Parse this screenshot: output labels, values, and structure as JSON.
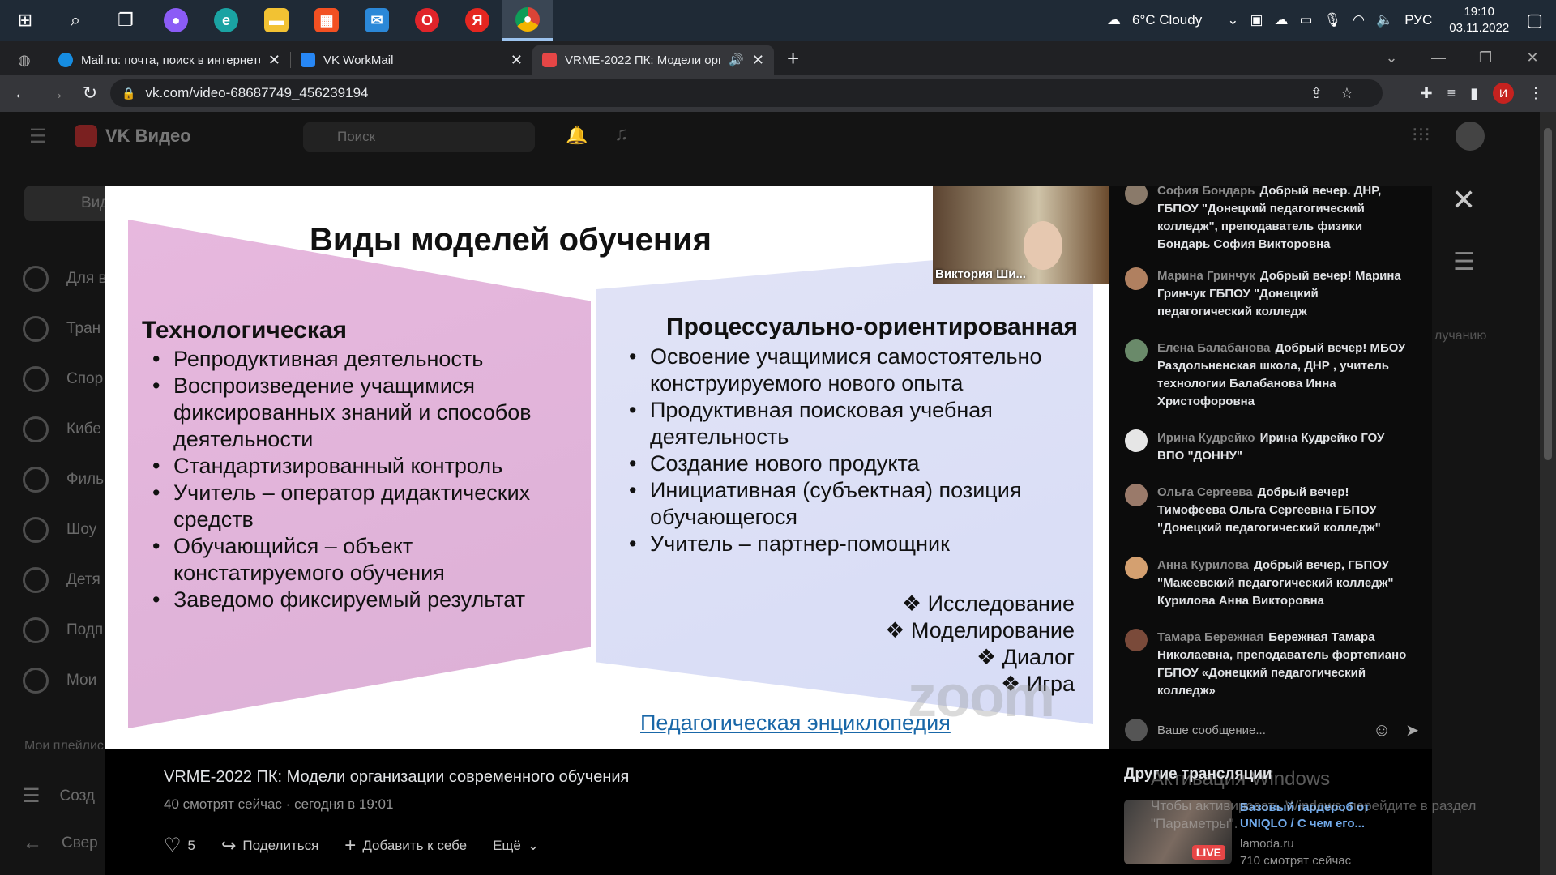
{
  "taskbar": {
    "weather": "6°C  Cloudy",
    "lang": "РУС",
    "time": "19:10",
    "date": "03.11.2022",
    "apps": [
      "windows-icon",
      "search-icon",
      "task-view-icon",
      "alice-icon",
      "edge-icon",
      "explorer-icon",
      "store-icon",
      "mail-icon",
      "opera-icon",
      "yandex-icon",
      "chrome-icon"
    ]
  },
  "browser": {
    "tabs": [
      {
        "title": "Mail.ru: почта, поиск в интернете",
        "color": "#168de2"
      },
      {
        "title": "VK WorkMail",
        "color": "#2787f5"
      },
      {
        "title": "VRME-2022 ПК: Модели орг",
        "color": "#e64646"
      }
    ],
    "url": "vk.com/video-68687749_456239194",
    "profile_initial": "И"
  },
  "vk": {
    "logo": "VK Видео",
    "search_placeholder": "Поиск",
    "sidebar": [
      "Для в",
      "Тран",
      "Спор",
      "Кибе",
      "Филь",
      "Шоу",
      "Детя",
      "Подп",
      "Мои"
    ],
    "sidebar_section": "Мои плейлис",
    "sidebar_create": "Созд",
    "sidebar_collapse": "Свер",
    "side_button": "Виде",
    "sort_label": "лучанию"
  },
  "slide": {
    "title": "Виды моделей обучения",
    "left_heading": "Технологическая",
    "left_items": [
      "Репродуктивная деятельность",
      "Воспроизведение учащимися фиксированных знаний и способов деятельности",
      "Стандартизированный контроль",
      "Учитель – оператор дидактических средств",
      "Обучающийся – объект констатируемого обучения",
      "Заведомо фиксируемый результат"
    ],
    "right_heading": "Процессуально-ориентированная",
    "right_items": [
      "Освоение учащимися самостоятельно конструируемого нового опыта",
      "Продуктивная поисковая учебная деятельность",
      "Создание нового продукта",
      "Инициативная (субъектная) позиция обучающегося",
      "Учитель – партнер-помощник"
    ],
    "forms": [
      "Исследование",
      "Моделирование",
      "Диалог",
      "Игра"
    ],
    "link": "Педагогическая энциклопедия",
    "watermark": "zoom",
    "speaker": "Виктория Ши..."
  },
  "video": {
    "title": "VRME-2022 ПК: Модели организации современного обучения",
    "viewers": "40 смотрят сейчас",
    "started": "сегодня в 19:01",
    "likes": "5",
    "share": "Поделиться",
    "add": "Добавить к себе",
    "more": "Ещё"
  },
  "chat": {
    "messages": [
      {
        "author": "София Бондарь",
        "text": "Добрый вечер. ДНР, ГБПОУ \"Донецкий педагогический колледж\", преподаватель физики Бондарь София Викторовна"
      },
      {
        "author": "Марина Гринчук",
        "text": "Добрый вечер! Марина Гринчук ГБПОУ \"Донецкий педагогический колледж"
      },
      {
        "author": "Елена Балабанова",
        "text": "Добрый вечер! МБОУ Раздольненская школа, ДНР , учитель технологии Балабанова Инна Христофоровна"
      },
      {
        "author": "Ирина Кудрейко",
        "text": "Ирина Кудрейко ГОУ ВПО \"ДОННУ\""
      },
      {
        "author": "Ольга Сергеева",
        "text": "Добрый вечер! Тимофеева Ольга Сергеевна ГБПОУ \"Донецкий педагогический колледж\""
      },
      {
        "author": "Анна Курилова",
        "text": "Добрый вечер, ГБПОУ \"Макеевский педагогический колледж\" Курилова Анна Викторовна"
      },
      {
        "author": "Тамара Бережная",
        "text": "Бережная Тамара Николаевна, преподаватель фортепиано ГБПОУ «Донецкий педагогический колледж»"
      }
    ],
    "input_placeholder": "Ваше сообщение..."
  },
  "others": {
    "title": "Другие трансляции",
    "card": {
      "title": "Базовый гардероб от UNIQLO / С чем его...",
      "source": "lamoda.ru",
      "viewers": "710 смотрят сейчас",
      "badge": "LIVE"
    }
  },
  "activation": {
    "title": "Активация Windows",
    "text": "Чтобы активировать Windows, перейдите в раздел \"Параметры\"."
  }
}
